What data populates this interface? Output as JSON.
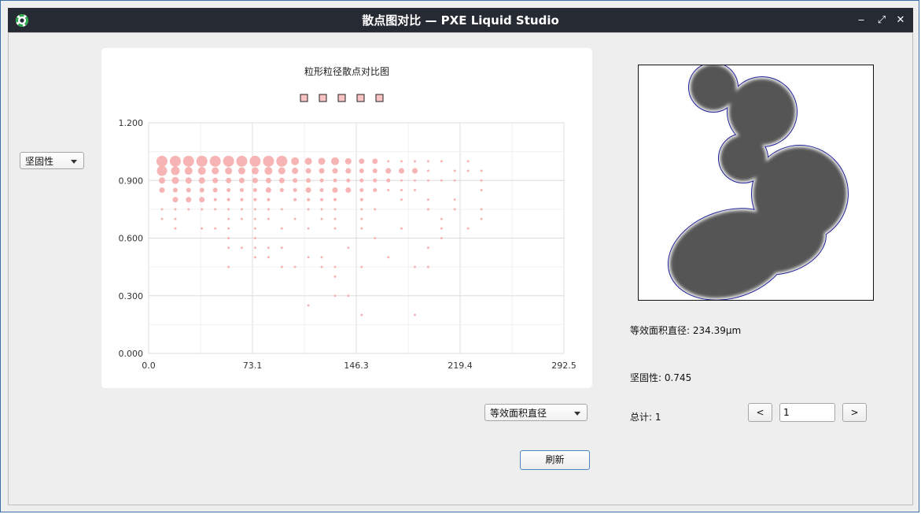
{
  "window": {
    "title": "散点图对比 — PXE Liquid Studio",
    "minimize_glyph": "‒",
    "restore_glyph": "⤢",
    "close_glyph": "✕"
  },
  "controls": {
    "y_metric": "坚固性",
    "x_metric": "等效面积直径",
    "refresh_label": "刷新"
  },
  "info": {
    "diameter_text": "等效面积直径: 234.39μm",
    "solidity_text": "坚固性: 0.745",
    "total_text": "总计:  1"
  },
  "pager": {
    "prev_label": "<",
    "next_label": ">",
    "current": "1"
  },
  "icons": {
    "app": "aperture-icon",
    "minimize": "minimize-icon",
    "restore": "restore-icon",
    "close": "close-icon"
  },
  "colors": {
    "point_fill": "#f7b4b4",
    "legend_fill": "#f9c3c3",
    "particle": "#555555",
    "particle_outline": "#1a1aa0"
  },
  "chart_data": {
    "type": "scatter",
    "title": "粒形粒径散点对比图",
    "xlim": [
      0,
      292.5
    ],
    "ylim": [
      0,
      1.2
    ],
    "x_ticks": [
      "0.0",
      "73.1",
      "146.3",
      "219.4",
      "292.5"
    ],
    "y_ticks": [
      "0.000",
      "0.300",
      "0.600",
      "0.900",
      "1.200"
    ],
    "legend_count": 5,
    "grid": true,
    "points": [
      [
        9.4,
        1.0,
        14
      ],
      [
        18.8,
        1.0,
        14
      ],
      [
        28.1,
        1.0,
        14
      ],
      [
        37.5,
        1.0,
        14
      ],
      [
        46.9,
        1.0,
        14
      ],
      [
        56.3,
        1.0,
        14
      ],
      [
        65.6,
        1.0,
        14
      ],
      [
        75.0,
        1.0,
        14
      ],
      [
        84.4,
        1.0,
        14
      ],
      [
        93.8,
        1.0,
        14
      ],
      [
        103.1,
        1.0,
        10
      ],
      [
        112.5,
        1.0,
        9
      ],
      [
        121.9,
        1.0,
        9
      ],
      [
        131.3,
        1.0,
        10
      ],
      [
        140.6,
        1.0,
        8
      ],
      [
        150.0,
        1.0,
        7
      ],
      [
        159.4,
        1.0,
        7
      ],
      [
        168.8,
        1.0,
        3
      ],
      [
        178.1,
        1.0,
        3
      ],
      [
        187.5,
        1.0,
        3
      ],
      [
        196.9,
        1.0,
        3
      ],
      [
        206.3,
        1.0,
        3
      ],
      [
        225.0,
        1.0,
        3
      ],
      [
        9.4,
        0.95,
        13
      ],
      [
        18.8,
        0.95,
        11
      ],
      [
        28.1,
        0.95,
        10
      ],
      [
        37.5,
        0.95,
        10
      ],
      [
        46.9,
        0.95,
        9
      ],
      [
        56.3,
        0.95,
        9
      ],
      [
        65.6,
        0.95,
        9
      ],
      [
        75.0,
        0.95,
        9
      ],
      [
        84.4,
        0.95,
        10
      ],
      [
        93.8,
        0.95,
        9
      ],
      [
        103.1,
        0.95,
        8
      ],
      [
        112.5,
        0.95,
        7
      ],
      [
        121.9,
        0.95,
        7
      ],
      [
        131.3,
        0.95,
        7
      ],
      [
        140.6,
        0.95,
        7
      ],
      [
        150.0,
        0.95,
        6
      ],
      [
        159.4,
        0.95,
        6
      ],
      [
        168.8,
        0.95,
        7
      ],
      [
        178.1,
        0.95,
        7
      ],
      [
        187.5,
        0.95,
        7
      ],
      [
        196.9,
        0.95,
        3
      ],
      [
        215.6,
        0.95,
        3
      ],
      [
        225.0,
        0.95,
        3
      ],
      [
        234.4,
        0.95,
        3
      ],
      [
        9.4,
        0.9,
        8
      ],
      [
        18.8,
        0.9,
        9
      ],
      [
        28.1,
        0.9,
        8
      ],
      [
        37.5,
        0.9,
        8
      ],
      [
        46.9,
        0.9,
        7
      ],
      [
        56.3,
        0.9,
        7
      ],
      [
        65.6,
        0.9,
        7
      ],
      [
        75.0,
        0.9,
        7
      ],
      [
        84.4,
        0.9,
        7
      ],
      [
        93.8,
        0.9,
        7
      ],
      [
        103.1,
        0.9,
        6
      ],
      [
        112.5,
        0.9,
        6
      ],
      [
        121.9,
        0.9,
        5
      ],
      [
        131.3,
        0.9,
        5
      ],
      [
        140.6,
        0.9,
        5
      ],
      [
        150.0,
        0.9,
        5
      ],
      [
        159.4,
        0.9,
        5
      ],
      [
        168.8,
        0.9,
        5
      ],
      [
        178.1,
        0.9,
        3
      ],
      [
        187.5,
        0.9,
        3
      ],
      [
        196.9,
        0.9,
        3
      ],
      [
        206.3,
        0.9,
        3
      ],
      [
        215.6,
        0.9,
        3
      ],
      [
        234.4,
        0.9,
        3
      ],
      [
        9.4,
        0.85,
        7
      ],
      [
        18.8,
        0.85,
        6
      ],
      [
        28.1,
        0.85,
        6
      ],
      [
        37.5,
        0.85,
        6
      ],
      [
        46.9,
        0.85,
        6
      ],
      [
        56.3,
        0.85,
        5
      ],
      [
        65.6,
        0.85,
        5
      ],
      [
        75.0,
        0.85,
        5
      ],
      [
        84.4,
        0.85,
        7
      ],
      [
        93.8,
        0.85,
        5
      ],
      [
        103.1,
        0.85,
        5
      ],
      [
        112.5,
        0.85,
        7
      ],
      [
        121.9,
        0.85,
        5
      ],
      [
        131.3,
        0.85,
        7
      ],
      [
        140.6,
        0.85,
        7
      ],
      [
        150.0,
        0.85,
        5
      ],
      [
        159.4,
        0.85,
        5
      ],
      [
        168.8,
        0.85,
        3
      ],
      [
        178.1,
        0.85,
        3
      ],
      [
        187.5,
        0.85,
        3
      ],
      [
        234.4,
        0.85,
        3
      ],
      [
        18.8,
        0.8,
        7
      ],
      [
        28.1,
        0.8,
        7
      ],
      [
        37.5,
        0.8,
        7
      ],
      [
        46.9,
        0.8,
        4
      ],
      [
        56.3,
        0.8,
        4
      ],
      [
        65.6,
        0.8,
        4
      ],
      [
        75.0,
        0.8,
        4
      ],
      [
        84.4,
        0.8,
        4
      ],
      [
        103.1,
        0.8,
        4
      ],
      [
        112.5,
        0.8,
        4
      ],
      [
        121.9,
        0.8,
        4
      ],
      [
        131.3,
        0.8,
        4
      ],
      [
        150.0,
        0.8,
        4
      ],
      [
        178.1,
        0.8,
        3
      ],
      [
        196.9,
        0.8,
        3
      ],
      [
        215.6,
        0.8,
        3
      ],
      [
        9.4,
        0.75,
        3
      ],
      [
        18.8,
        0.75,
        3
      ],
      [
        28.1,
        0.75,
        3
      ],
      [
        37.5,
        0.75,
        3
      ],
      [
        46.9,
        0.75,
        3
      ],
      [
        56.3,
        0.75,
        3
      ],
      [
        65.6,
        0.75,
        3
      ],
      [
        75.0,
        0.75,
        3
      ],
      [
        84.4,
        0.75,
        3
      ],
      [
        93.8,
        0.75,
        3
      ],
      [
        112.5,
        0.75,
        3
      ],
      [
        121.9,
        0.75,
        3
      ],
      [
        131.3,
        0.75,
        3
      ],
      [
        150.0,
        0.75,
        3
      ],
      [
        159.4,
        0.75,
        3
      ],
      [
        196.9,
        0.75,
        3
      ],
      [
        215.6,
        0.75,
        3
      ],
      [
        234.4,
        0.75,
        3
      ],
      [
        9.4,
        0.7,
        3
      ],
      [
        18.8,
        0.7,
        3
      ],
      [
        56.3,
        0.7,
        3
      ],
      [
        65.6,
        0.7,
        3
      ],
      [
        75.0,
        0.7,
        3
      ],
      [
        84.4,
        0.7,
        3
      ],
      [
        103.1,
        0.7,
        3
      ],
      [
        121.9,
        0.7,
        3
      ],
      [
        131.3,
        0.7,
        3
      ],
      [
        150.0,
        0.7,
        3
      ],
      [
        206.3,
        0.7,
        3
      ],
      [
        234.4,
        0.7,
        3
      ],
      [
        18.8,
        0.65,
        3
      ],
      [
        37.5,
        0.65,
        3
      ],
      [
        46.9,
        0.65,
        3
      ],
      [
        56.3,
        0.65,
        3
      ],
      [
        75.0,
        0.65,
        3
      ],
      [
        93.8,
        0.65,
        3
      ],
      [
        112.5,
        0.65,
        3
      ],
      [
        131.3,
        0.65,
        3
      ],
      [
        150.0,
        0.65,
        3
      ],
      [
        178.1,
        0.65,
        3
      ],
      [
        206.3,
        0.65,
        3
      ],
      [
        225.0,
        0.65,
        3
      ],
      [
        56.3,
        0.6,
        3
      ],
      [
        75.0,
        0.6,
        3
      ],
      [
        159.4,
        0.6,
        3
      ],
      [
        206.3,
        0.6,
        3
      ],
      [
        56.3,
        0.55,
        3
      ],
      [
        65.6,
        0.55,
        3
      ],
      [
        75.0,
        0.55,
        3
      ],
      [
        84.4,
        0.55,
        3
      ],
      [
        93.8,
        0.55,
        3
      ],
      [
        140.6,
        0.55,
        3
      ],
      [
        196.9,
        0.55,
        3
      ],
      [
        75.0,
        0.5,
        3
      ],
      [
        84.4,
        0.5,
        3
      ],
      [
        112.5,
        0.5,
        3
      ],
      [
        121.9,
        0.5,
        3
      ],
      [
        168.8,
        0.5,
        3
      ],
      [
        56.3,
        0.45,
        3
      ],
      [
        93.8,
        0.45,
        3
      ],
      [
        103.1,
        0.45,
        3
      ],
      [
        121.9,
        0.45,
        3
      ],
      [
        131.3,
        0.45,
        3
      ],
      [
        150.0,
        0.45,
        3
      ],
      [
        187.5,
        0.45,
        3
      ],
      [
        196.9,
        0.45,
        3
      ],
      [
        131.3,
        0.4,
        3
      ],
      [
        131.3,
        0.3,
        3
      ],
      [
        140.6,
        0.3,
        3
      ],
      [
        112.5,
        0.25,
        3
      ],
      [
        150.0,
        0.2,
        3
      ],
      [
        187.5,
        0.2,
        3
      ]
    ]
  }
}
